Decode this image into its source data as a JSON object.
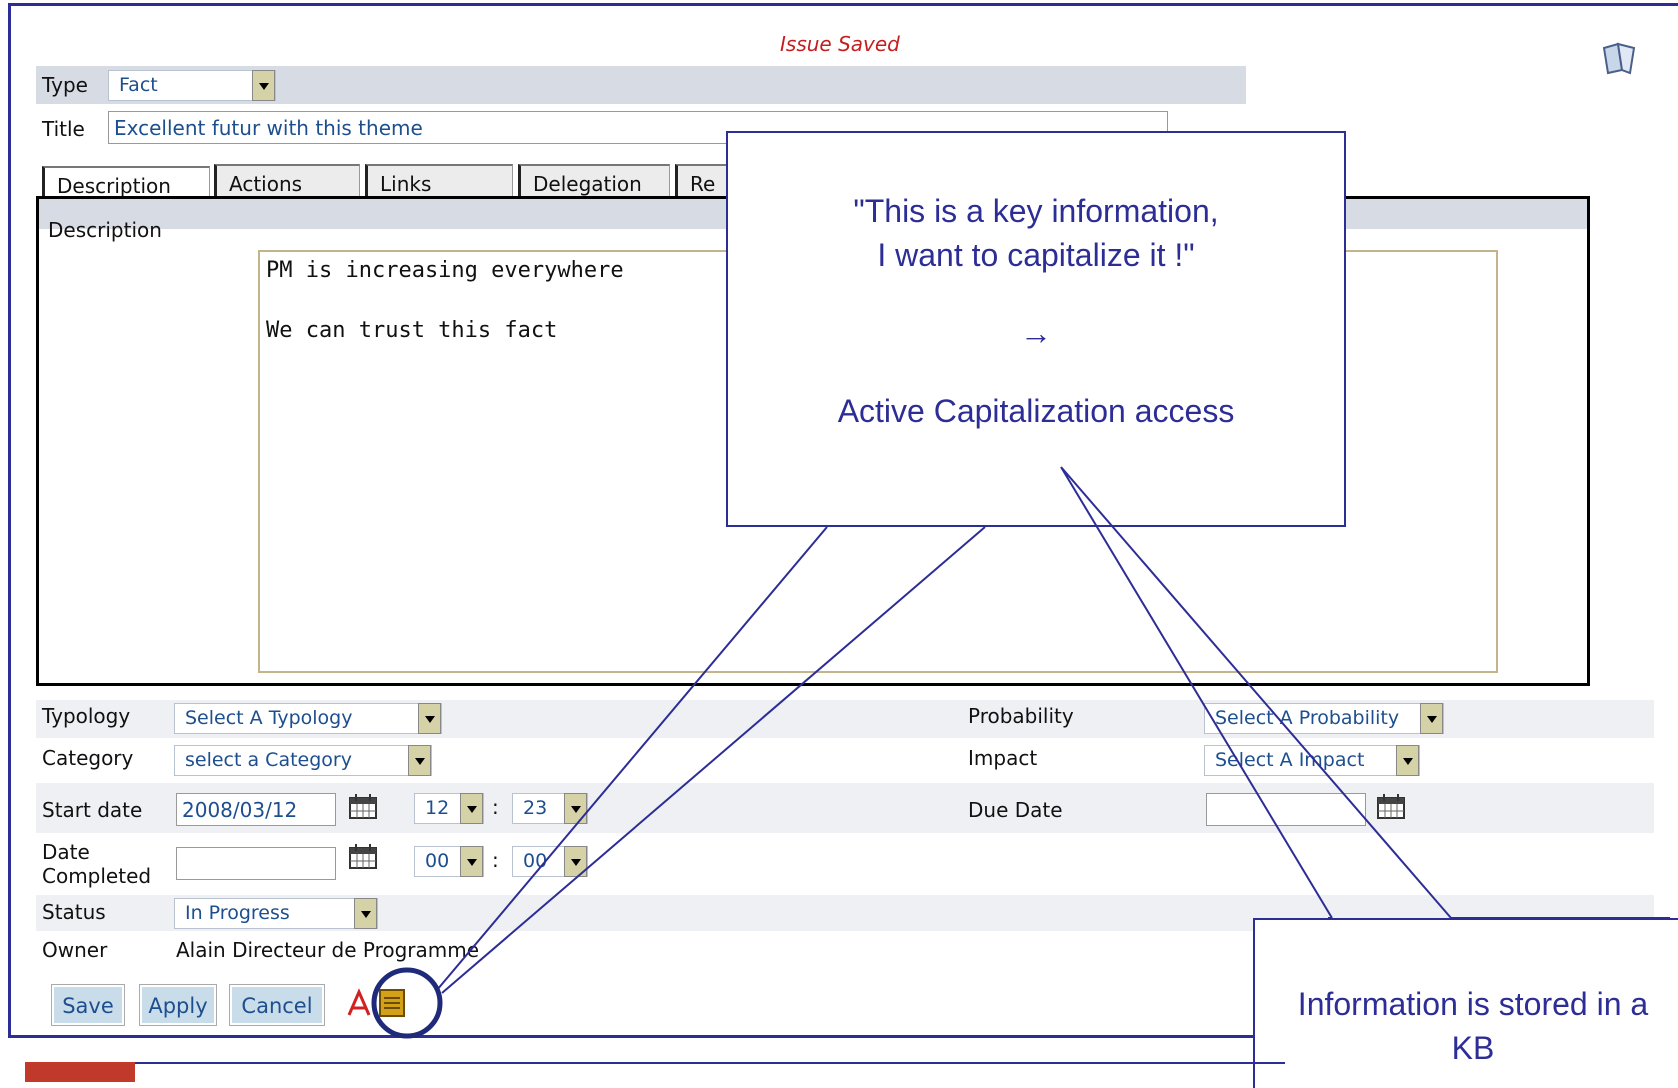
{
  "status_message": "Issue Saved",
  "type": {
    "label": "Type",
    "value": "Fact"
  },
  "title": {
    "label": "Title",
    "value": "Excellent futur with this theme"
  },
  "tabs": [
    "Description",
    "Actions",
    "Links",
    "Delegation",
    "Re"
  ],
  "description": {
    "section_label": "Description",
    "line1": "PM is increasing everywhere",
    "line2": "We can trust this fact"
  },
  "fields": {
    "typology": {
      "label": "Typology",
      "value": "Select A Typology"
    },
    "category": {
      "label": "Category",
      "value": "select a Category"
    },
    "start_date": {
      "label": "Start date",
      "value": "2008/03/12",
      "hour": "12",
      "minute": "23"
    },
    "date_completed": {
      "label_line1": "Date",
      "label_line2": "Completed",
      "value": "",
      "hour": "00",
      "minute": "00"
    },
    "status": {
      "label": "Status",
      "value": "In Progress"
    },
    "owner": {
      "label": "Owner",
      "value": "Alain Directeur de Programme"
    },
    "probability": {
      "label": "Probability",
      "value": "Select A Probability"
    },
    "impact": {
      "label": "Impact",
      "value": "Select A Impact"
    },
    "due_date": {
      "label": "Due Date",
      "value": ""
    }
  },
  "buttons": {
    "save": "Save",
    "apply": "Apply",
    "cancel": "Cancel"
  },
  "callout_top": {
    "line1": "\"This is a key information,",
    "line2": "I want to capitalize it !\"",
    "arrow": "→",
    "line3": "Active Capitalization access"
  },
  "callout_bottom": {
    "line1": "Information is stored in a",
    "line2": "KB"
  },
  "colors": {
    "accent": "#2d2d96",
    "notice": "#c41f1f",
    "field_text": "#1d4f8f"
  }
}
